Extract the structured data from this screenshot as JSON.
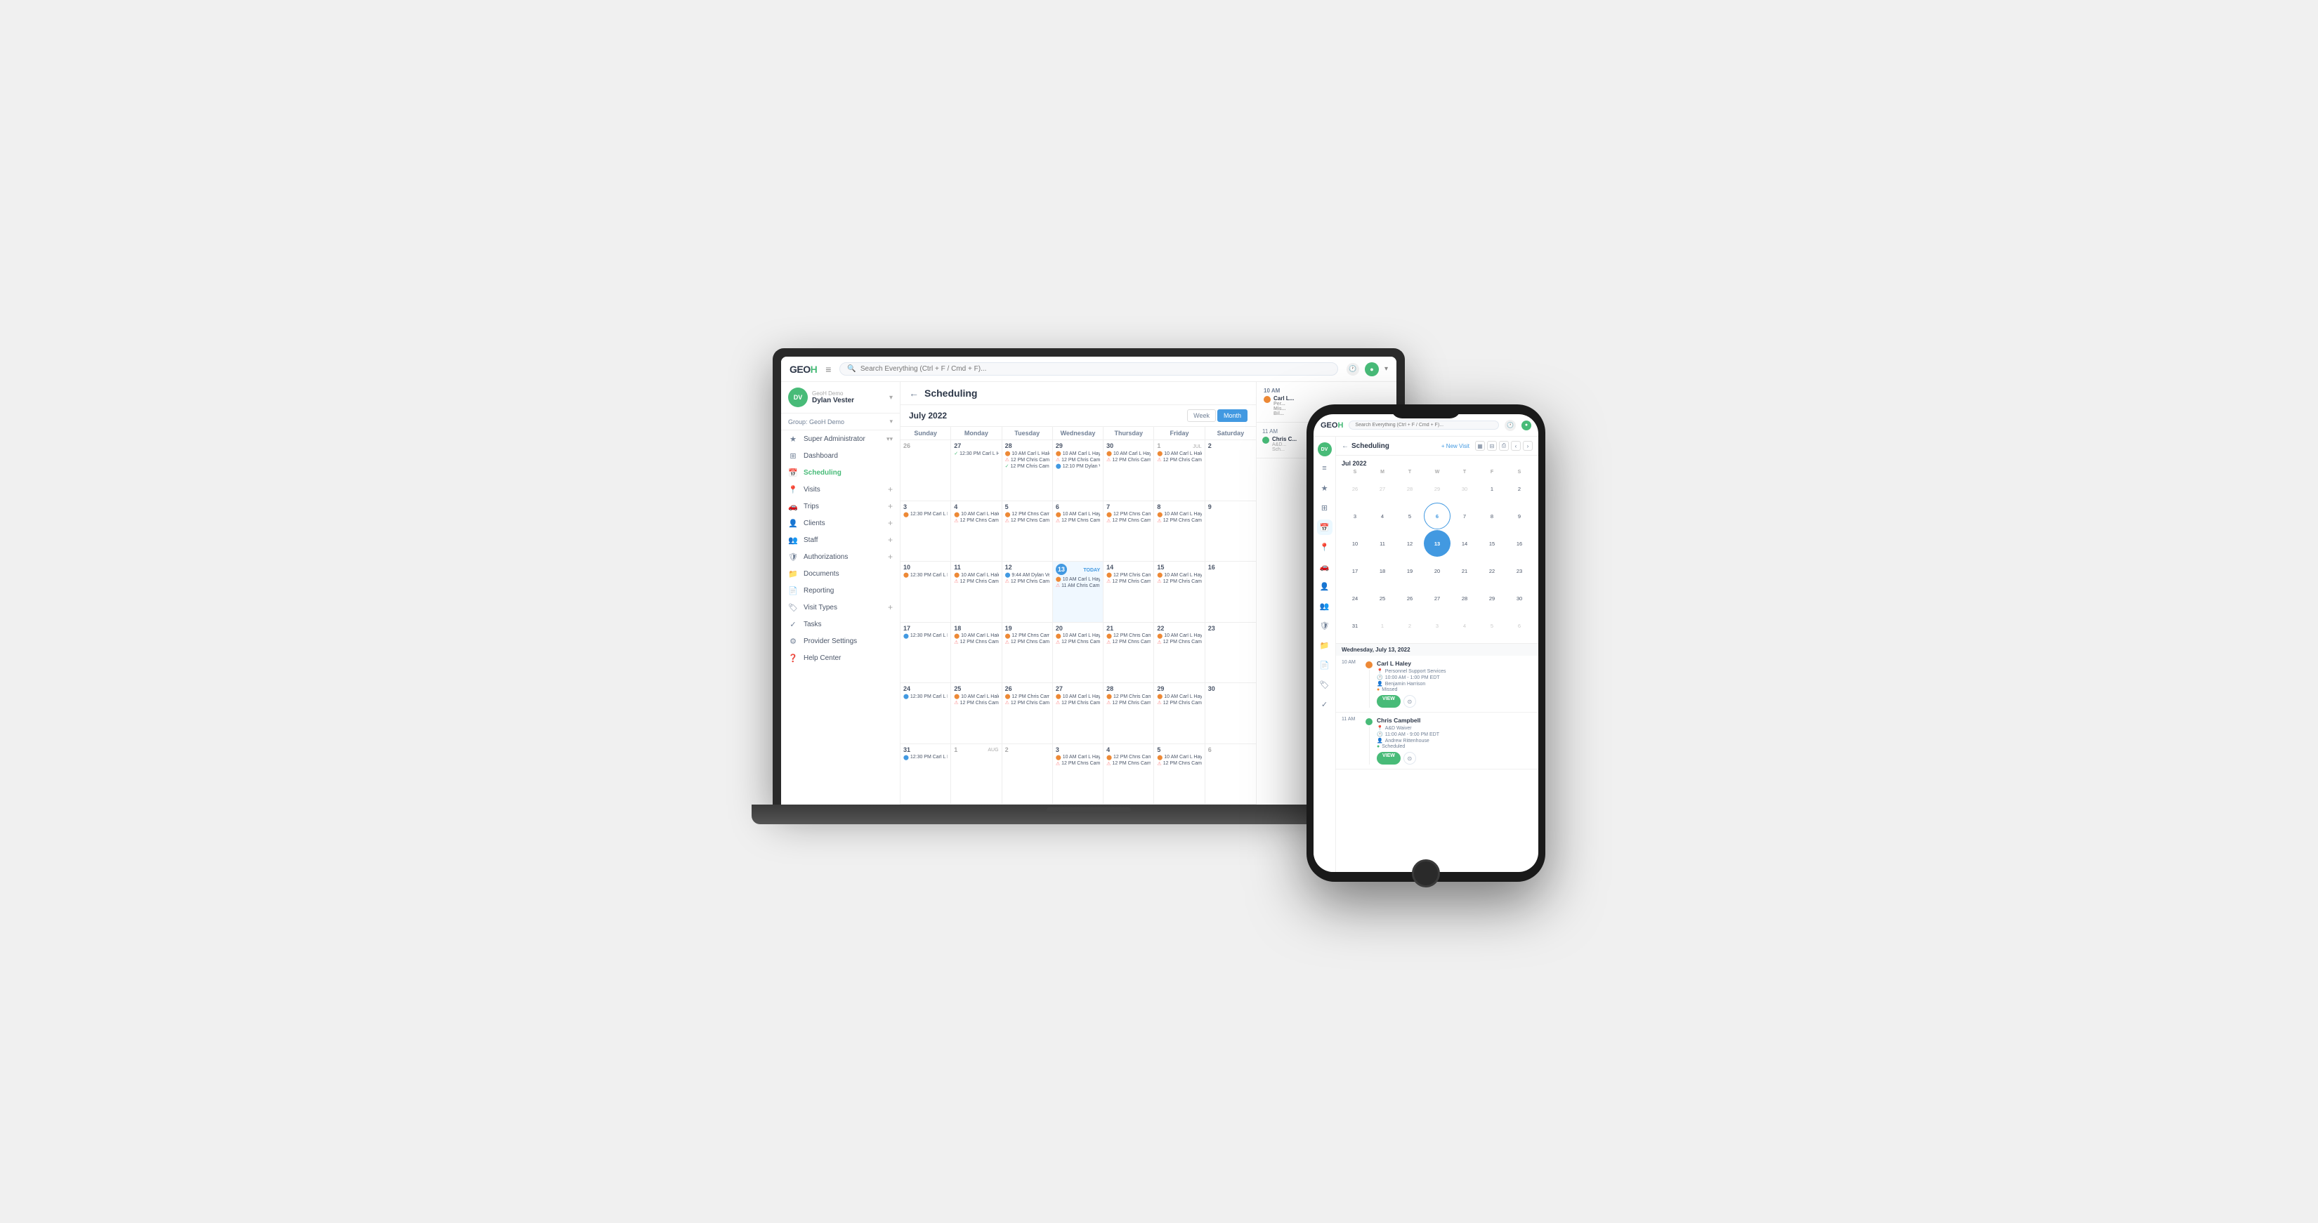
{
  "app": {
    "logo_text": "GEO",
    "logo_accent": "H",
    "search_placeholder": "Search Everything (Ctrl + F / Cmd + F)..."
  },
  "user": {
    "initials": "DV",
    "demo_label": "GeoH Demo",
    "name": "Dylan Vester"
  },
  "group": {
    "label": "Group: GeoH Demo"
  },
  "sidebar": {
    "items": [
      {
        "label": "Super Administrator",
        "icon": "★"
      },
      {
        "label": "Dashboard",
        "icon": "⊞"
      },
      {
        "label": "Scheduling",
        "icon": "📅"
      },
      {
        "label": "Visits",
        "icon": "📍"
      },
      {
        "label": "Trips",
        "icon": "🚗"
      },
      {
        "label": "Clients",
        "icon": "👤"
      },
      {
        "label": "Staff",
        "icon": "👥"
      },
      {
        "label": "Authorizations",
        "icon": "🛡"
      },
      {
        "label": "Documents",
        "icon": "📁"
      },
      {
        "label": "Reporting",
        "icon": "📄"
      },
      {
        "label": "Visit Types",
        "icon": "🏷"
      },
      {
        "label": "Tasks",
        "icon": "✓"
      },
      {
        "label": "Provider Settings",
        "icon": "⚙"
      },
      {
        "label": "Help Center",
        "icon": "❓"
      }
    ]
  },
  "scheduling": {
    "title": "Scheduling",
    "month_label": "July 2022",
    "view_week": "Week",
    "view_month": "Month",
    "days": [
      "Sunday",
      "Monday",
      "Tuesday",
      "Wednesday",
      "Thursday",
      "Friday",
      "Saturday"
    ],
    "today_date": "13",
    "side_panel_date": "Wednesday, July 13, 2",
    "weeks": [
      {
        "dates": [
          "26",
          "27",
          "28",
          "29",
          "30",
          "1",
          "2"
        ],
        "other": [
          false,
          false,
          false,
          false,
          false,
          true,
          false
        ],
        "events": [
          [],
          [
            {
              "time": "12:30 PM",
              "name": "Carl L Hak",
              "dot": "green",
              "check": true
            }
          ],
          [
            {
              "time": "10 AM",
              "name": "Carl L Haley",
              "dot": "orange"
            },
            {
              "time": "12 PM",
              "name": "Chris Camptb",
              "dot": "red"
            },
            {
              "time": "",
              "name": "Chris Camptb",
              "dot": "green",
              "check": true
            }
          ],
          [
            {
              "time": "10 AM",
              "name": "Carl L Hay...",
              "dot": "orange"
            },
            {
              "time": "12 PM",
              "name": "Chris Campt",
              "dot": "red"
            },
            {
              "time": "12:10 PM",
              "name": "Dylan Vest...",
              "dot": "blue"
            }
          ],
          [
            {
              "time": "10 AM",
              "name": "Carl L Hay...",
              "dot": "orange"
            },
            {
              "time": "12 PM",
              "name": "Chris Campt",
              "dot": "red"
            }
          ],
          [
            {
              "time": "10 AM",
              "name": "Carl L Haley",
              "dot": "orange"
            },
            {
              "time": "12 PM",
              "name": "Chris Campt",
              "dot": "red"
            }
          ],
          []
        ]
      },
      {
        "dates": [
          "3",
          "4",
          "5",
          "6",
          "7",
          "8",
          "9"
        ],
        "other": [
          false,
          false,
          false,
          false,
          false,
          false,
          false
        ],
        "events": [
          [
            {
              "time": "12:30 PM",
              "name": "Carl L Hak",
              "dot": "orange"
            }
          ],
          [
            {
              "time": "10 AM",
              "name": "Carl L Haley",
              "dot": "orange"
            },
            {
              "time": "12 PM",
              "name": "Chris Campt",
              "dot": "red"
            }
          ],
          [
            {
              "time": "12 PM",
              "name": "Chris Campt",
              "dot": "orange"
            },
            {
              "time": "12 PM",
              "name": "Chris Campt",
              "dot": "red"
            }
          ],
          [
            {
              "time": "10 AM",
              "name": "Carl L Hay...",
              "dot": "orange"
            },
            {
              "time": "12 PM",
              "name": "Chris Campt",
              "dot": "red"
            }
          ],
          [
            {
              "time": "12 PM",
              "name": "Chris Campt",
              "dot": "orange"
            },
            {
              "time": "12 PM",
              "name": "Chris Campt",
              "dot": "red"
            }
          ],
          [
            {
              "time": "10 AM",
              "name": "Carl L Hay...",
              "dot": "orange"
            },
            {
              "time": "12 PM",
              "name": "Chris Campt",
              "dot": "red"
            }
          ],
          []
        ]
      },
      {
        "dates": [
          "10",
          "11",
          "12",
          "13",
          "14",
          "15",
          "16"
        ],
        "today_idx": 3,
        "other": [
          false,
          false,
          false,
          false,
          false,
          false,
          false
        ],
        "events": [
          [
            {
              "time": "12:30 PM",
              "name": "Carl L Hak",
              "dot": "orange"
            }
          ],
          [
            {
              "time": "10 AM",
              "name": "Carl L Haley",
              "dot": "orange"
            },
            {
              "time": "12 PM",
              "name": "Chris Campt",
              "dot": "red"
            }
          ],
          [
            {
              "time": "9:44 AM",
              "name": "Dylan Vest...",
              "dot": "blue"
            },
            {
              "time": "12 PM",
              "name": "Chris Campt",
              "dot": "red"
            }
          ],
          [
            {
              "time": "10 AM",
              "name": "Carl L Hay...",
              "dot": "orange"
            },
            {
              "time": "11 AM",
              "name": "Chris Campt",
              "dot": "red"
            }
          ],
          [
            {
              "time": "12 PM",
              "name": "Chris Campt",
              "dot": "orange"
            },
            {
              "time": "12 PM",
              "name": "Chris Campt",
              "dot": "red"
            }
          ],
          [
            {
              "time": "10 AM",
              "name": "Carl L Hay...",
              "dot": "orange"
            },
            {
              "time": "12 PM",
              "name": "Chris Campt",
              "dot": "red"
            }
          ],
          []
        ]
      },
      {
        "dates": [
          "17",
          "18",
          "19",
          "20",
          "21",
          "22",
          "23"
        ],
        "other": [
          false,
          false,
          false,
          false,
          false,
          false,
          false
        ],
        "events": [
          [
            {
              "time": "12:30 PM",
              "name": "Carl L Hak",
              "dot": "orange"
            }
          ],
          [
            {
              "time": "10 AM",
              "name": "Carl L Haley",
              "dot": "orange"
            },
            {
              "time": "12 PM",
              "name": "Chris Campt",
              "dot": "red"
            }
          ],
          [
            {
              "time": "12 PM",
              "name": "Chris Campt",
              "dot": "orange"
            },
            {
              "time": "12 PM",
              "name": "Chris Campt",
              "dot": "red"
            }
          ],
          [
            {
              "time": "10 AM",
              "name": "Carl L Hay...",
              "dot": "orange"
            },
            {
              "time": "12 PM",
              "name": "Chris Campt",
              "dot": "red"
            }
          ],
          [
            {
              "time": "12 PM",
              "name": "Chris Campt",
              "dot": "orange"
            },
            {
              "time": "12 PM",
              "name": "Chris Campt",
              "dot": "red"
            }
          ],
          [
            {
              "time": "10 AM",
              "name": "Carl L Hay...",
              "dot": "orange"
            },
            {
              "time": "12 PM",
              "name": "Chris Campt",
              "dot": "red"
            }
          ],
          []
        ]
      },
      {
        "dates": [
          "24",
          "25",
          "26",
          "27",
          "28",
          "29",
          "30"
        ],
        "other": [
          false,
          false,
          false,
          false,
          false,
          false,
          false
        ],
        "events": [
          [
            {
              "time": "12:30 PM",
              "name": "Carl L Hak",
              "dot": "orange"
            }
          ],
          [
            {
              "time": "10 AM",
              "name": "Carl L Haley",
              "dot": "orange"
            },
            {
              "time": "12 PM",
              "name": "Chris Campt",
              "dot": "red"
            }
          ],
          [
            {
              "time": "12 PM",
              "name": "Chris Campt",
              "dot": "orange"
            },
            {
              "time": "12 PM",
              "name": "Chris Campt",
              "dot": "red"
            }
          ],
          [
            {
              "time": "10 AM",
              "name": "Carl L Hay...",
              "dot": "orange"
            },
            {
              "time": "12 PM",
              "name": "Chris Campt",
              "dot": "red"
            }
          ],
          [
            {
              "time": "12 PM",
              "name": "Chris Campt",
              "dot": "orange"
            },
            {
              "time": "12 PM",
              "name": "Chris Campt",
              "dot": "red"
            }
          ],
          [
            {
              "time": "10 AM",
              "name": "Carl L Hay...",
              "dot": "orange"
            },
            {
              "time": "12 PM",
              "name": "Chris Campt",
              "dot": "red"
            }
          ],
          []
        ]
      },
      {
        "dates": [
          "31",
          "1",
          "2",
          "3",
          "4",
          "5",
          "6"
        ],
        "other": [
          false,
          true,
          true,
          false,
          false,
          false,
          false
        ],
        "events": [
          [
            {
              "time": "12:30 PM",
              "name": "Carl L Hak",
              "dot": "orange"
            }
          ],
          [],
          [],
          [
            {
              "time": "10 AM",
              "name": "Carl L Hay...",
              "dot": "orange"
            },
            {
              "time": "12 PM",
              "name": "Chris Campt",
              "dot": "red"
            }
          ],
          [
            {
              "time": "12 PM",
              "name": "Chris Campt",
              "dot": "orange"
            },
            {
              "time": "12 PM",
              "name": "Chris Campt",
              "dot": "red"
            }
          ],
          [
            {
              "time": "10 AM",
              "name": "Carl L Hay...",
              "dot": "orange"
            },
            {
              "time": "12 PM",
              "name": "Chris Campt",
              "dot": "red"
            }
          ],
          []
        ]
      }
    ]
  },
  "phone": {
    "logo": "GEO",
    "logo_accent": "H",
    "scheduling_title": "Scheduling",
    "new_visit_label": "+ New Visit",
    "mini_cal_title": "Jul 2022",
    "mini_cal_days_header": [
      "S",
      "M",
      "T",
      "W",
      "T",
      "F",
      "S"
    ],
    "mini_cal_weeks": [
      [
        "26",
        "27",
        "28",
        "29",
        "30",
        "1",
        "2"
      ],
      [
        "3",
        "4",
        "5",
        "6",
        "7",
        "8",
        "9"
      ],
      [
        "10",
        "11",
        "12",
        "13",
        "14",
        "15",
        "16"
      ],
      [
        "17",
        "18",
        "19",
        "20",
        "21",
        "22",
        "23"
      ],
      [
        "24",
        "25",
        "26",
        "27",
        "28",
        "29",
        "30"
      ],
      [
        "31",
        "1",
        "2",
        "3",
        "4",
        "5",
        "6"
      ]
    ],
    "mini_cal_today": "13",
    "day_label": "Wednesday, July 13, 2022",
    "events": [
      {
        "time": "10 AM",
        "dot_color": "#ed8936",
        "name": "Carl L Haley",
        "service": "Personnel Support Services",
        "time_range": "10:00 AM - 1:00 PM EDT",
        "staff": "Benjamin Harrison",
        "status": "Missed",
        "view_btn": "VIEW",
        "status_dot": "orange"
      },
      {
        "time": "11 AM",
        "dot_color": "#48bb78",
        "name": "Chris Campbell",
        "service": "A&D Waiver",
        "time_range": "11:00 AM - 9:00 PM EDT",
        "staff": "Andrew Rittenhouse",
        "status": "Scheduled",
        "view_btn": "VIEW",
        "status_dot": "green"
      }
    ]
  }
}
